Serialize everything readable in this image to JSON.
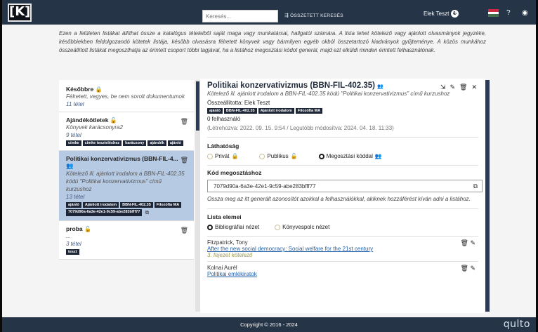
{
  "header": {
    "logo": "[K]",
    "search_placeholder": "Keresés...",
    "advanced_search": "ÖSSZETETT KERESÉS",
    "user_name": "Elek Teszt",
    "flag_colors": [
      "#cd2a3e",
      "#ffffff",
      "#436f4d"
    ]
  },
  "intro": "Ezen a felületen listákat állíthat össze a katalógus tételeiből saját maga vagy munkatársai, hallgatói számára. A lista lehet kötelező vagy ajánlott olvasmányok jegyzéke, későbbiekben feldolgozandó kötetek listája, később olvasásra félretett könyvek vagy bármilyen egyéb okból összetartozó kiadványok gyűjteménye. A közös munkához összeállított listákat megoszthatja az érintett csoport többi tagjával, ha a listához megosztási kódot generál, majd ezt elküldi minden érintett felhasználónak.",
  "lists": [
    {
      "title": "Későbbre",
      "desc": "Félretett, vegyes, be nem sorolt dokumentumok",
      "count": "11 tétel",
      "tags": []
    },
    {
      "title": "Ajándékötletek",
      "desc": "Könyvek karácsonyra2",
      "count": "9 tétel",
      "tags": [
        "címke",
        "címke teszteléshez",
        "karácsony",
        "ajándék",
        "ajánló"
      ]
    },
    {
      "title": "Politikai konzervativizmus (BBN-FIL-4...",
      "desc": "Kötelező ill. ajánlott irodalom a BBN-FIL-402.35 kódú \"Politikai konzervativizmus\" című kurzushoz",
      "count": "13 tétel",
      "tags": [
        "ajánló",
        "Ajánlott irodalom",
        "BBN-FIL-402.35",
        "Filozófia MA",
        "7079d90a-6a3e-42e1-9c59-abe283bfff77"
      ]
    },
    {
      "title": "proba",
      "desc": "...",
      "count": "3 tétel",
      "tags": [
        "teszt"
      ]
    }
  ],
  "detail": {
    "title": "Politikai konzervativizmus (BBN-FIL-402.35)",
    "subtitle": "Kötelező ill. ajánlott irodalom a BBN-FIL-402.35 kódú \"Politikai konzervativizmus\" című kurzushoz",
    "author": "Összeállította: Elek Teszt",
    "tags": [
      "ajánló",
      "BBN-FIL-402.35",
      "Ajánlott irodalom",
      "Filozófia MA"
    ],
    "users": "0 felhasználó",
    "dates": "(Létrehozva: 2022. 09. 15. 9:54 / Legutóbb módosítva: 2024. 04. 18. 11:33)",
    "visibility_label": "Láthatóság",
    "visibility_options": [
      "Privát",
      "Publikus",
      "Megosztási kóddal"
    ],
    "visibility_selected": "Megosztási kóddal",
    "share_code_label": "Kód megosztáshoz",
    "share_code": "7079d90a-6a3e-42e1-9c59-abe283bfff77",
    "share_help": "Ossza meg az itt generált azonosítót azokkal a felhasználókkal, akiknek hozzáférést kíván adni a listához.",
    "elements_label": "Lista elemei",
    "view_options": [
      "Bibliográfiai nézet",
      "Könyvespolc nézet"
    ],
    "view_selected": "Bibliográfiai nézet",
    "entries": [
      {
        "author": "Fitzpatrick, Tony",
        "title": "After the new social democracy: Social welfare for the 21st century",
        "note": "3. fejezet kötelező"
      },
      {
        "author": "Kolnai Aurél",
        "title": "Politikai emlékiratok",
        "note": ""
      }
    ]
  },
  "footer": {
    "copyright": "Copyright © 2016 - 2024",
    "brand": "qulto"
  }
}
